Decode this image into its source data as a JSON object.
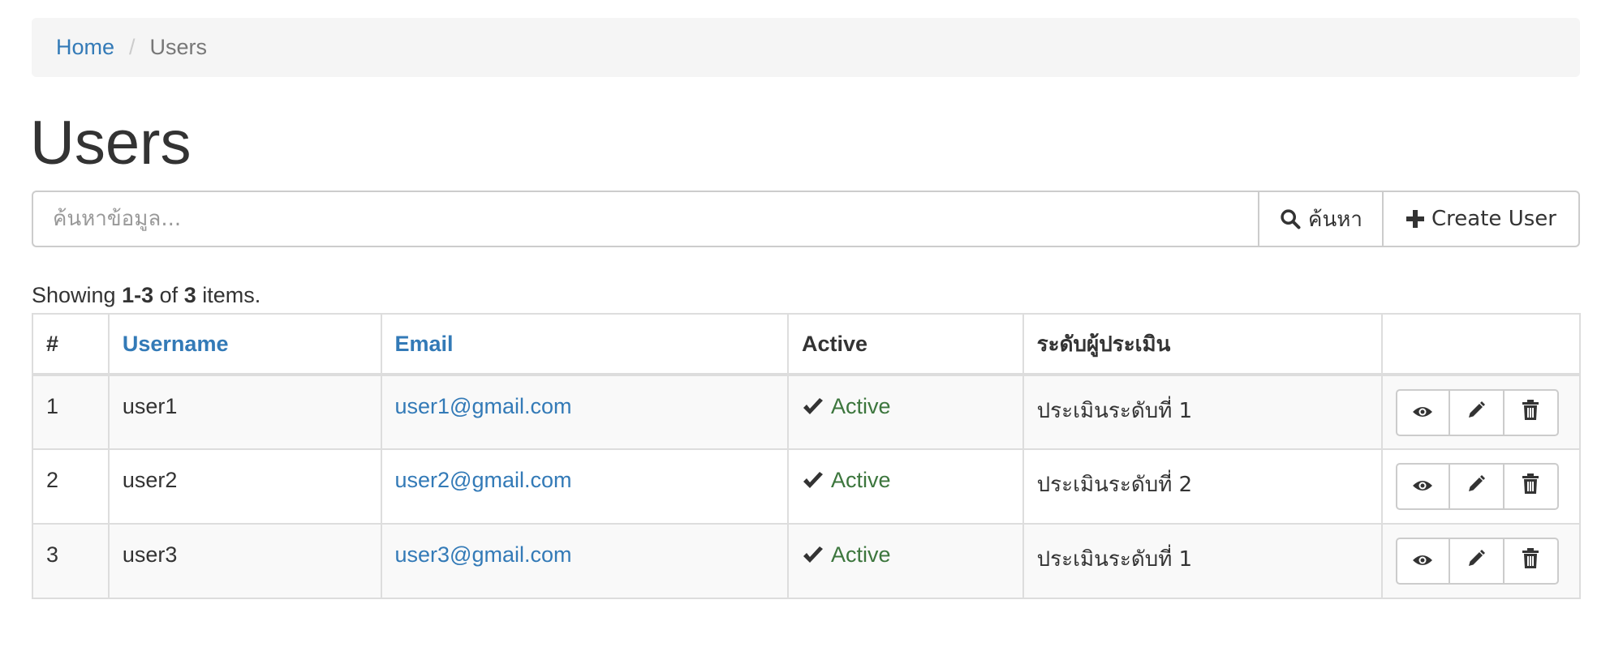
{
  "breadcrumb": {
    "home": "Home",
    "separator": "/",
    "current": "Users"
  },
  "page": {
    "title": "Users"
  },
  "search": {
    "placeholder": "ค้นหาข้อมูล...",
    "value": "",
    "button_label": "ค้นหา",
    "button_icon": "search-icon",
    "create_label": "Create User",
    "create_icon": "plus-icon"
  },
  "summary": {
    "prefix": "Showing",
    "range": "1-3",
    "of": "of",
    "total": "3",
    "suffix": "items."
  },
  "table": {
    "headers": {
      "num": "#",
      "username": "Username",
      "email": "Email",
      "active": "Active",
      "level": "ระดับผู้ประเมิน"
    },
    "rows": [
      {
        "num": "1",
        "username": "user1",
        "email": "user1@gmail.com",
        "active": "Active",
        "level": "ประเมินระดับที่ 1"
      },
      {
        "num": "2",
        "username": "user2",
        "email": "user2@gmail.com",
        "active": "Active",
        "level": "ประเมินระดับที่ 2"
      },
      {
        "num": "3",
        "username": "user3",
        "email": "user3@gmail.com",
        "active": "Active",
        "level": "ประเมินระดับที่ 1"
      }
    ],
    "row_actions": [
      "eye-icon",
      "pencil-icon",
      "trash-icon"
    ]
  },
  "colors": {
    "link": "#337ab7",
    "active_status": "#3c763d",
    "border": "#dddddd",
    "stripe": "#f9f9f9",
    "breadcrumb_bg": "#f5f5f5"
  }
}
